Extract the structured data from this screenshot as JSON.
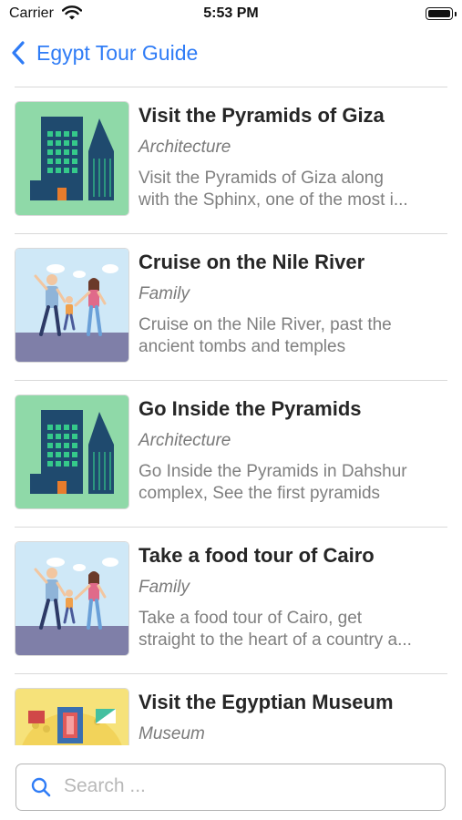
{
  "status_bar": {
    "carrier": "Carrier",
    "time": "5:53 PM"
  },
  "nav": {
    "back_label": "Egypt Tour Guide"
  },
  "colors": {
    "accent": "#2f7cf6",
    "divider": "#d9d9d9"
  },
  "tours": [
    {
      "title": "Visit the Pyramids of Giza",
      "category": "Architecture",
      "desc_lines": [
        "Visit the Pyramids of Giza along",
        "with the Sphinx, one of the most i..."
      ],
      "image": "city-buildings"
    },
    {
      "title": "Cruise on the Nile River",
      "category": "Family",
      "desc_lines": [
        "Cruise on the Nile River, past the",
        "ancient tombs and temples"
      ],
      "image": "family-walking"
    },
    {
      "title": "Go Inside the Pyramids",
      "category": "Architecture",
      "desc_lines": [
        "Go Inside the Pyramids in Dahshur",
        "complex, See the first pyramids"
      ],
      "image": "city-buildings"
    },
    {
      "title": "Take a food tour of Cairo",
      "category": "Family",
      "desc_lines": [
        "Take a food tour of Cairo, get",
        "straight to the heart of a country a..."
      ],
      "image": "family-walking"
    },
    {
      "title": "Visit the Egyptian Museum",
      "category": "Museum",
      "desc_lines": [],
      "image": "museum-art"
    }
  ],
  "search": {
    "placeholder": "Search ..."
  }
}
